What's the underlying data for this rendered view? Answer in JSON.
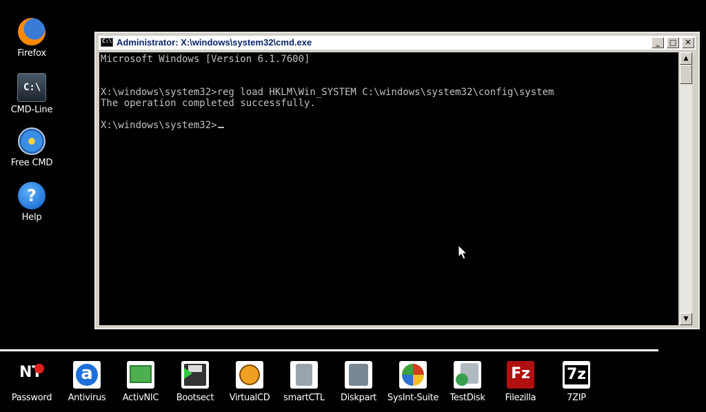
{
  "desktop_icons": [
    {
      "label": "Firefox",
      "icon": "firefox-icon"
    },
    {
      "label": "CMD-Line",
      "icon": "terminal-icon"
    },
    {
      "label": "Free CMD",
      "icon": "free-cmd-icon"
    },
    {
      "label": "Help",
      "icon": "help-icon"
    }
  ],
  "cmd_icon_text": "C:\\",
  "help_icon_text": "?",
  "window": {
    "title": "Administrator: X:\\windows\\system32\\cmd.exe",
    "minimize": "_",
    "maximize": "□",
    "close": "✕",
    "console_lines": [
      "Microsoft Windows [Version 6.1.7600]",
      "",
      "X:\\windows\\system32>reg load HKLM\\Win_SYSTEM C:\\windows\\system32\\config\\system",
      "The operation completed successfully.",
      "",
      "X:\\windows\\system32>"
    ],
    "scroll_up": "▲",
    "scroll_down": "▼"
  },
  "taskbar": [
    {
      "label": "Password",
      "icon": "password-key-icon",
      "color": "#e02020"
    },
    {
      "label": "Antivirus",
      "icon": "avast-icon",
      "color": "#1e6fd9"
    },
    {
      "label": "ActivNIC",
      "icon": "network-card-icon",
      "color": "#4caf50"
    },
    {
      "label": "Bootsect",
      "icon": "floppy-disk-icon",
      "color": "#333333"
    },
    {
      "label": "VirtualCD",
      "icon": "virtual-cd-icon",
      "color": "#f0a020"
    },
    {
      "label": "smartCTL",
      "icon": "hard-drive-icon",
      "color": "#9aa4ad"
    },
    {
      "label": "Diskpart",
      "icon": "diskpart-icon",
      "color": "#7a8894"
    },
    {
      "label": "SysInt-Suite",
      "icon": "sysinternals-icon",
      "color": "#d04020"
    },
    {
      "label": "TestDisk",
      "icon": "testdisk-icon",
      "color": "#3aa050"
    },
    {
      "label": "Filezilla",
      "icon": "filezilla-icon",
      "color": "#b01010"
    },
    {
      "label": "7ZIP",
      "icon": "7zip-icon",
      "color": "#000000"
    }
  ],
  "taskbar_icon_text": {
    "password": "NT",
    "antivirus": "a",
    "filezilla": "Fz",
    "sevenzip": "7z"
  }
}
